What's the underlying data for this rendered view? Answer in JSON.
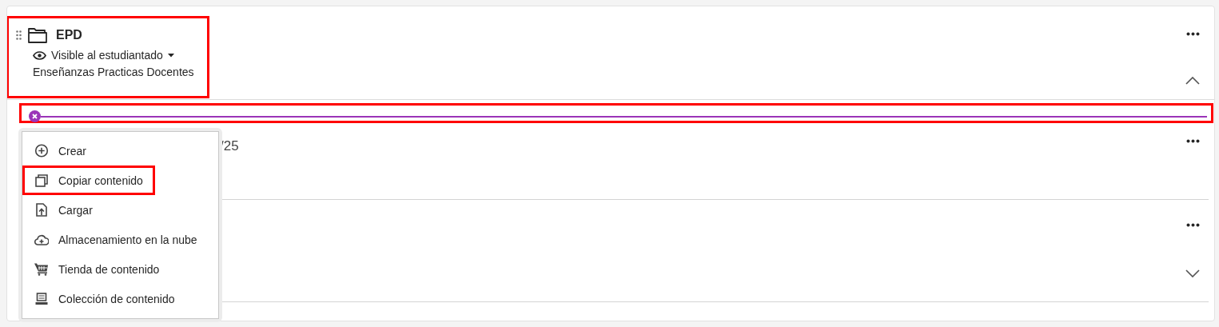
{
  "folder": {
    "title": "EPD",
    "visibility": "Visible al estudiantado",
    "description": "Enseñanzas Practicas Docentes",
    "expanded": true,
    "highlighted": true
  },
  "insert_line": {
    "highlighted": true
  },
  "items": [
    {
      "kind": "item",
      "title": "/25"
    },
    {
      "kind": "folder",
      "expanded": false
    }
  ],
  "menu": {
    "items": [
      {
        "kind": "create",
        "label": "Crear",
        "highlighted": false
      },
      {
        "kind": "copy",
        "label": "Copiar contenido",
        "highlighted": true
      },
      {
        "kind": "upload",
        "label": "Cargar",
        "highlighted": false
      },
      {
        "kind": "cloud",
        "label": "Almacenamiento en la nube",
        "highlighted": false
      },
      {
        "kind": "store",
        "label": "Tienda de contenido",
        "highlighted": false
      },
      {
        "kind": "collection",
        "label": "Colección de contenido",
        "highlighted": false
      }
    ]
  }
}
